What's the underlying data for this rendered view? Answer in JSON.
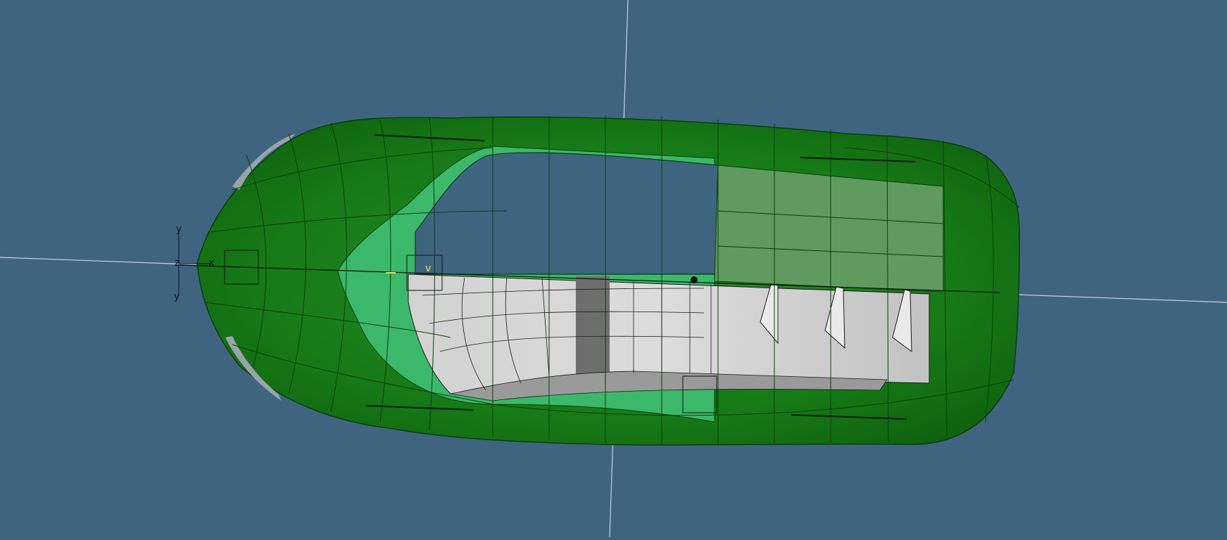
{
  "viewport": {
    "background": "#3e6480",
    "axis_line_color": "#c9d3da"
  },
  "triad": {
    "label_y_top": "y",
    "label_z": "z",
    "label_x": "x",
    "label_y_bottom": "y"
  },
  "origin_marker": {
    "label": "v"
  },
  "model": {
    "outer_surface_color": "#167a16",
    "outer_surface_dark": "#0f5f0f",
    "inner_band_color": "#3bb86a",
    "interior_color": "#c8c8c8",
    "interior_dark": "#6e6e6e",
    "flat_panel_color": "#5f9b5f",
    "gray_edge_color": "#9aa3ad"
  }
}
